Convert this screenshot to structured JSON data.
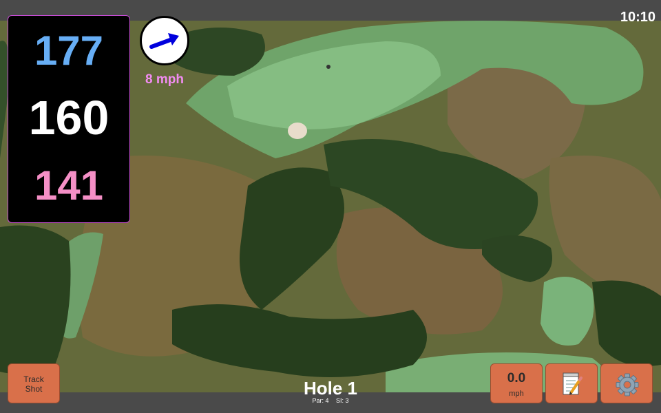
{
  "status_bar": {
    "time": "10:10"
  },
  "distances": {
    "back": "177",
    "middle": "160",
    "front": "141"
  },
  "wind": {
    "speed": "8 mph",
    "icon": "wind-direction-arrow-icon"
  },
  "hole": {
    "title": "Hole 1",
    "par": "Par: 4",
    "stroke_index": "SI: 3"
  },
  "buttons": {
    "track_shot": {
      "line1": "Track",
      "line2": "Shot"
    },
    "speed": {
      "value": "0.0",
      "unit": "mph"
    },
    "notes_icon": "notepad-icon",
    "settings_icon": "gear-icon"
  },
  "colors": {
    "back_distance": "#67aef5",
    "middle_distance": "#ffffff",
    "front_distance": "#f58fc6",
    "wind_text": "#f28cf2",
    "wind_arrow": "#0000dd",
    "button_bg": "#d9704a",
    "panel_border": "#c64dd4"
  }
}
